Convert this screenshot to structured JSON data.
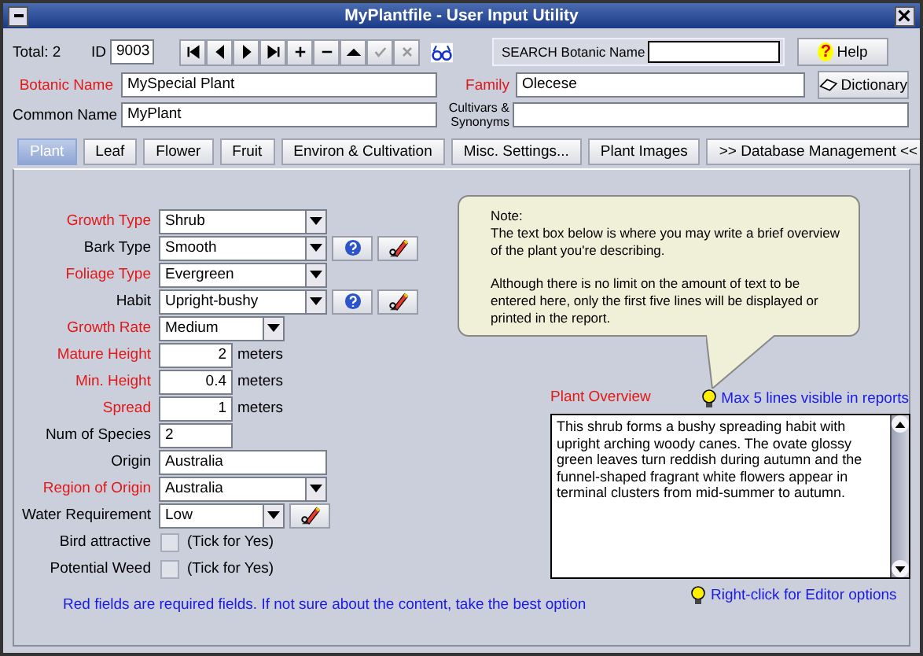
{
  "window": {
    "title": "MyPlantfile - User Input Utility"
  },
  "header": {
    "total": "Total: 2",
    "id_label": "ID",
    "id_value": "9003",
    "navigator": [
      {
        "kind": "first",
        "disabled": false
      },
      {
        "kind": "prev",
        "disabled": false
      },
      {
        "kind": "next",
        "disabled": false
      },
      {
        "kind": "last",
        "disabled": false
      },
      {
        "kind": "add",
        "disabled": false
      },
      {
        "kind": "remove",
        "disabled": false
      },
      {
        "kind": "up",
        "disabled": false
      },
      {
        "kind": "confirm",
        "disabled": true
      },
      {
        "kind": "cancel",
        "disabled": true
      }
    ],
    "search": {
      "label": "SEARCH Botanic Name"
    },
    "help_button": "Help",
    "help_mark": "?",
    "dictionary_button": "Dictionary",
    "botanic_name": {
      "label": "Botanic Name",
      "required": true,
      "value": "MySpecial Plant"
    },
    "family": {
      "label": "Family",
      "required": true,
      "value": "Olecese"
    },
    "common_name": {
      "label": "Common Name",
      "required": false,
      "value": "MyPlant"
    },
    "cultivars": {
      "label": "Cultivars & Synonyms",
      "required": false
    }
  },
  "tabs": [
    {
      "label": "Plant",
      "selected": true
    },
    {
      "label": "Leaf",
      "selected": false
    },
    {
      "label": "Flower",
      "selected": false
    },
    {
      "label": "Fruit",
      "selected": false
    },
    {
      "label": "Environ & Cultivation",
      "selected": false
    },
    {
      "label": "Misc. Settings...",
      "selected": false
    },
    {
      "label": "Plant Images",
      "selected": false
    },
    {
      "label": ">> Database  Management <<",
      "selected": false
    }
  ],
  "fields": [
    {
      "label": "Growth Type",
      "required": true,
      "kind": "select",
      "value": "Shrub"
    },
    {
      "label": "Bark Type",
      "required": false,
      "kind": "select",
      "value": "Smooth",
      "help": true,
      "editor": true
    },
    {
      "label": "Foliage Type",
      "required": true,
      "kind": "select",
      "value": "Evergreen"
    },
    {
      "label": "Habit",
      "required": false,
      "kind": "select",
      "value": "Upright-bushy",
      "help": true,
      "editor": true
    },
    {
      "label": "Growth Rate",
      "required": true,
      "kind": "dropdown",
      "value": "Medium"
    },
    {
      "label": "Mature Height",
      "required": true,
      "kind": "number",
      "value": "2",
      "unit": "meters"
    },
    {
      "label": "Min. Height",
      "required": true,
      "kind": "number",
      "value": "0.4",
      "unit": "meters"
    },
    {
      "label": "Spread",
      "required": true,
      "kind": "number",
      "value": "1",
      "unit": "meters"
    },
    {
      "label": "Num of Species",
      "required": false,
      "kind": "short",
      "value": "2"
    },
    {
      "label": "Origin",
      "required": false,
      "kind": "text",
      "value": "Australia"
    },
    {
      "label": "Region of Origin",
      "required": true,
      "kind": "select",
      "value": "Australia"
    },
    {
      "label": "Water Requirement",
      "required": false,
      "kind": "dropdown",
      "value": "Low",
      "editor": true
    },
    {
      "label": "Bird attractive",
      "required": false,
      "kind": "checkbox",
      "checked": false,
      "hint": "(Tick for Yes)"
    },
    {
      "label": "Potential Weed",
      "required": false,
      "kind": "checkbox",
      "checked": false,
      "hint": "(Tick for Yes)"
    }
  ],
  "footer_tip": "Red fields are required fields. If not sure about the content, take the best option",
  "note": {
    "title": "Note:",
    "paragraphs": [
      "The text box below is where you may write a brief overview of the plant you're describing.",
      "Although there is no limit on the amount of text to be entered here, only the first five lines will be displayed or printed in the report."
    ]
  },
  "overview": {
    "label": "Plant Overview",
    "tip": "Max 5 lines visible in reports",
    "text": "This shrub forms a bushy spreading habit with upright arching woody canes. The ovate glossy green leaves turn reddish during autumn and the funnel-shaped fragrant white flowers appear in terminal clusters from mid-summer to autumn.",
    "editor_tip": "Right-click for Editor options"
  }
}
